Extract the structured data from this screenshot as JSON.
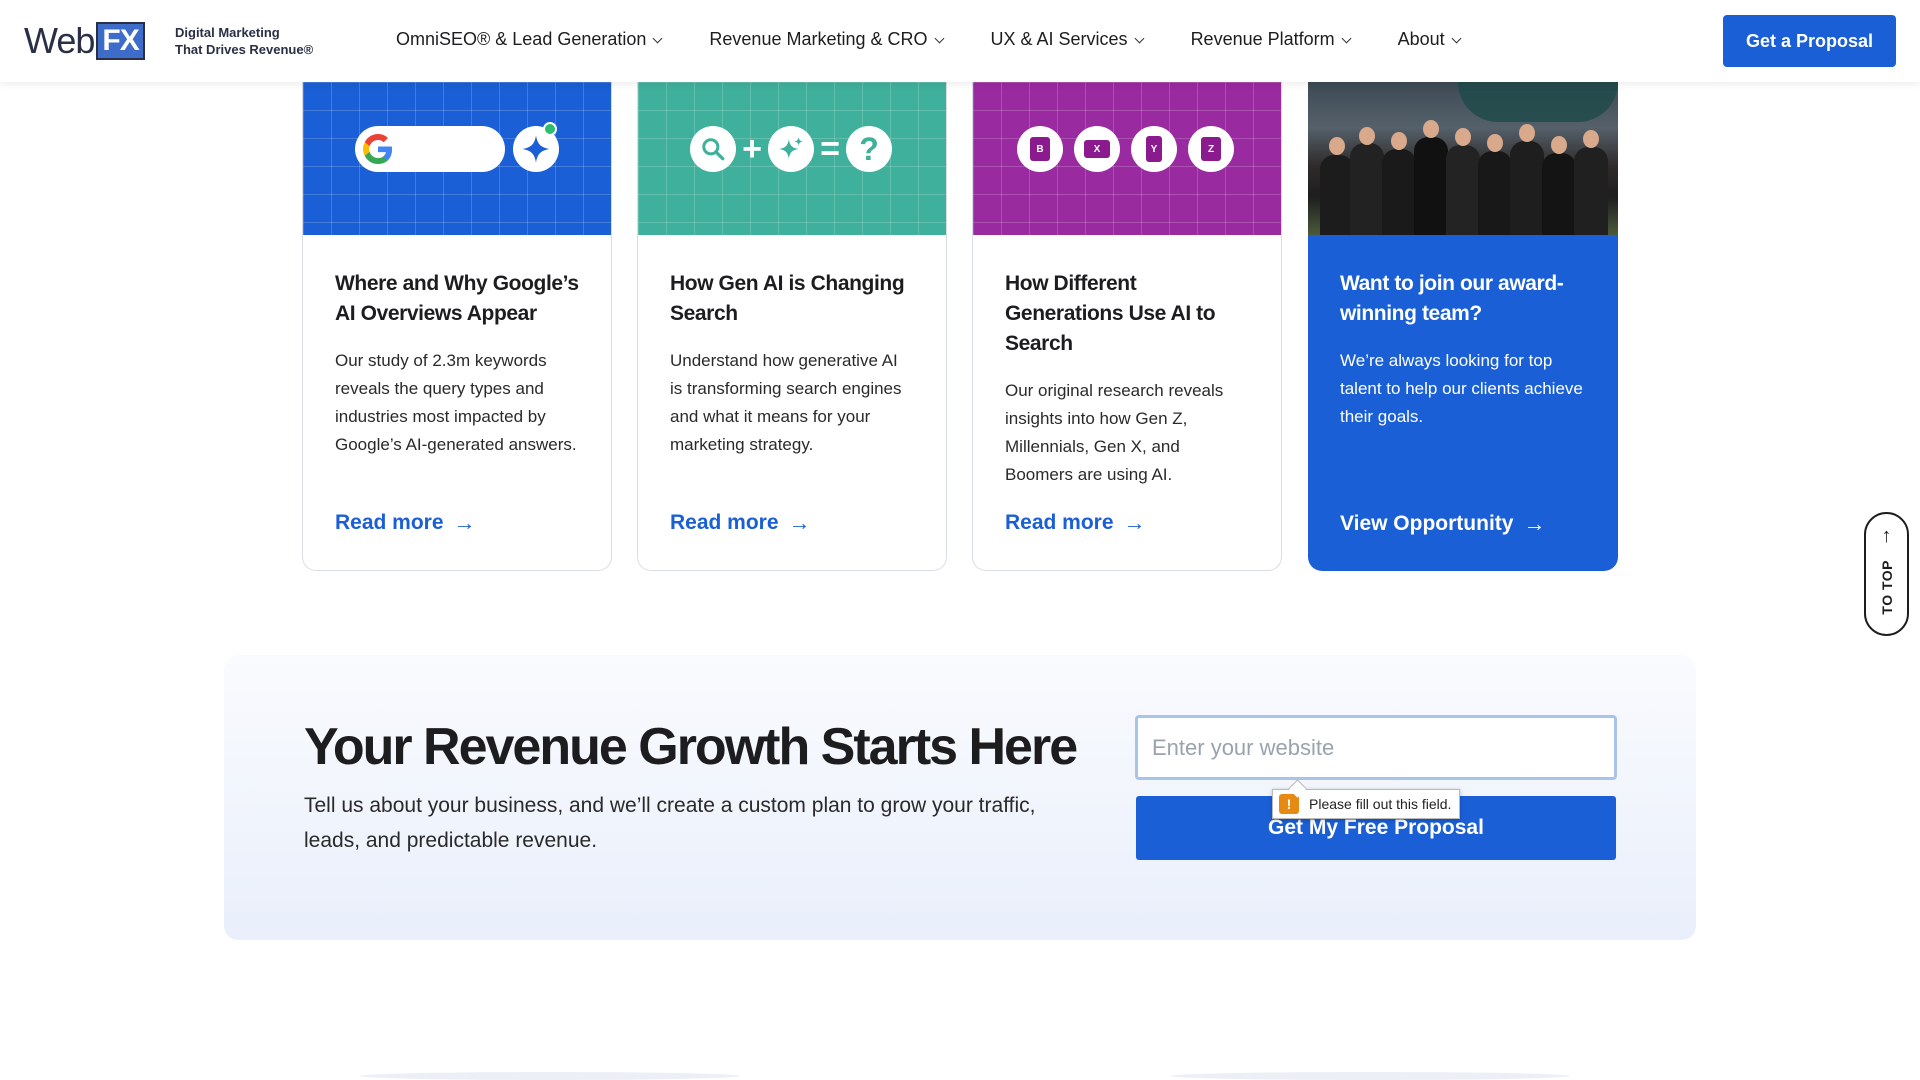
{
  "header": {
    "logo_web": "Web",
    "logo_fx": "FX",
    "tagline_line1": "Digital Marketing",
    "tagline_line2": "That Drives Revenue®",
    "nav": [
      {
        "label": "OmniSEO® & Lead Generation"
      },
      {
        "label": "Revenue Marketing & CRO"
      },
      {
        "label": "UX & AI Services"
      },
      {
        "label": "Revenue Platform"
      },
      {
        "label": "About"
      }
    ],
    "cta_label": "Get a Proposal"
  },
  "cards": [
    {
      "title": "Where and Why Google’s AI Overviews Appear",
      "text": "Our study of 2.3m keywords reveals the query types and industries most impacted by Google’s AI-generated answers.",
      "link": "Read more",
      "bg_color": "#1a5fd6"
    },
    {
      "title": "How Gen AI is Changing Search",
      "text": "Understand how generative AI is transforming search engines and what it means for your marketing strategy.",
      "link": "Read more",
      "bg_color": "#3fb09b"
    },
    {
      "title": "How Different Generations Use AI to Search",
      "text": "Our original research reveals insights into how Gen Z, Millennials, Gen X, and Boomers are using AI.",
      "link": "Read more",
      "bg_color": "#9a2aa0",
      "badges": [
        "B",
        "X",
        "Y",
        "Z"
      ]
    },
    {
      "title": "Want to join our award-winning team?",
      "text": "We’re always looking for top talent to help our clients achieve their goals.",
      "link": "View Opportunity",
      "bg_color": "#1a5fd6"
    }
  ],
  "to_top": {
    "label": "TO TOP"
  },
  "cta_section": {
    "title": "Your Revenue Growth Starts Here",
    "description": "Tell us about your business, and we’ll create a custom plan to grow your traffic, leads, and predictable revenue.",
    "input_placeholder": "Enter your website",
    "input_value": "",
    "button_label": "Get My Free Proposal",
    "validation_message": "Please fill out this field."
  },
  "colors": {
    "brand_blue": "#1a5fd6",
    "warning": "#e68a13"
  }
}
